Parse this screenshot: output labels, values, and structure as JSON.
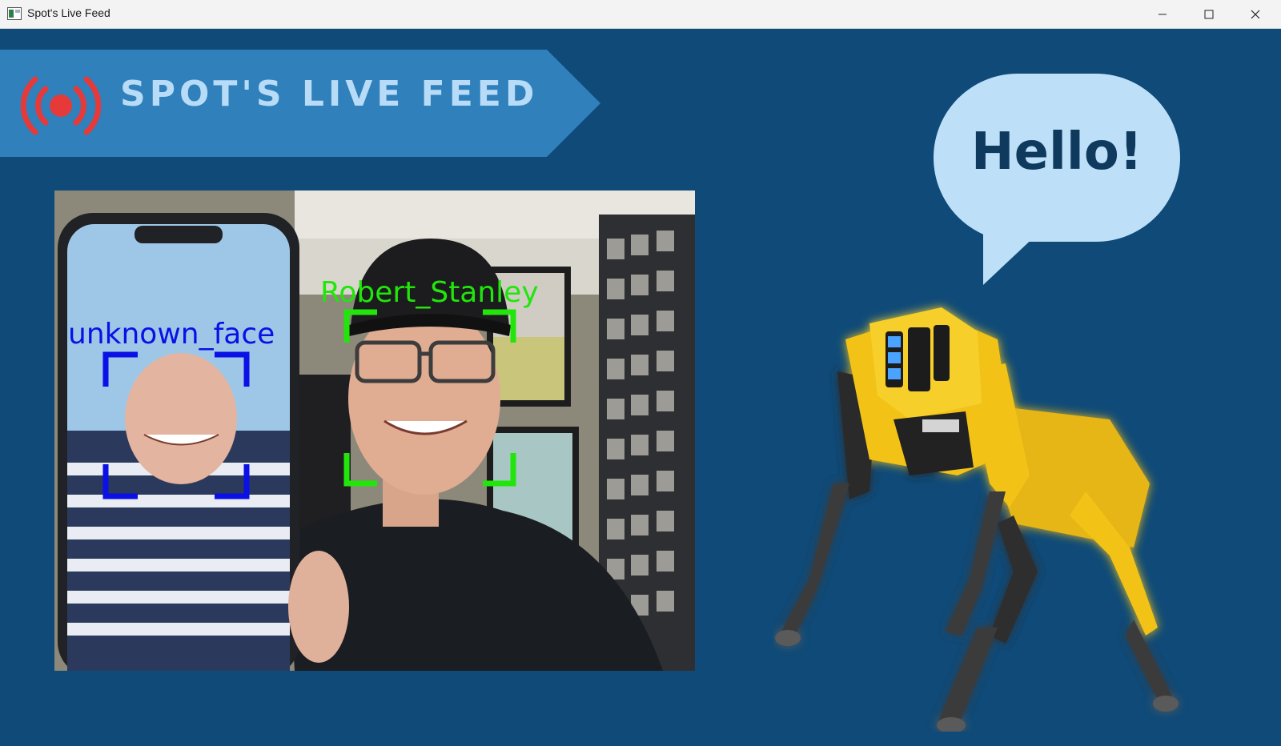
{
  "window": {
    "title": "Spot's Live Feed",
    "icons": [
      "app-icon",
      "minimize-icon",
      "maximize-icon",
      "close-icon"
    ]
  },
  "banner": {
    "title": "SPOT'S LIVE FEED",
    "icon": "broadcast-icon"
  },
  "feed": {
    "faces": [
      {
        "label": "unknown_face",
        "box_color": "#0a10e6"
      },
      {
        "label": "Robert_Stanley",
        "box_color": "#22e60b"
      }
    ]
  },
  "speech": {
    "text": "Hello!"
  },
  "colors": {
    "background": "#0f4a78",
    "banner": "#2f80bb",
    "banner_text": "#b8dcf7",
    "live_red": "#e63a3a",
    "bubble": "#bde0f8",
    "robot_yellow": "#f2c318"
  }
}
